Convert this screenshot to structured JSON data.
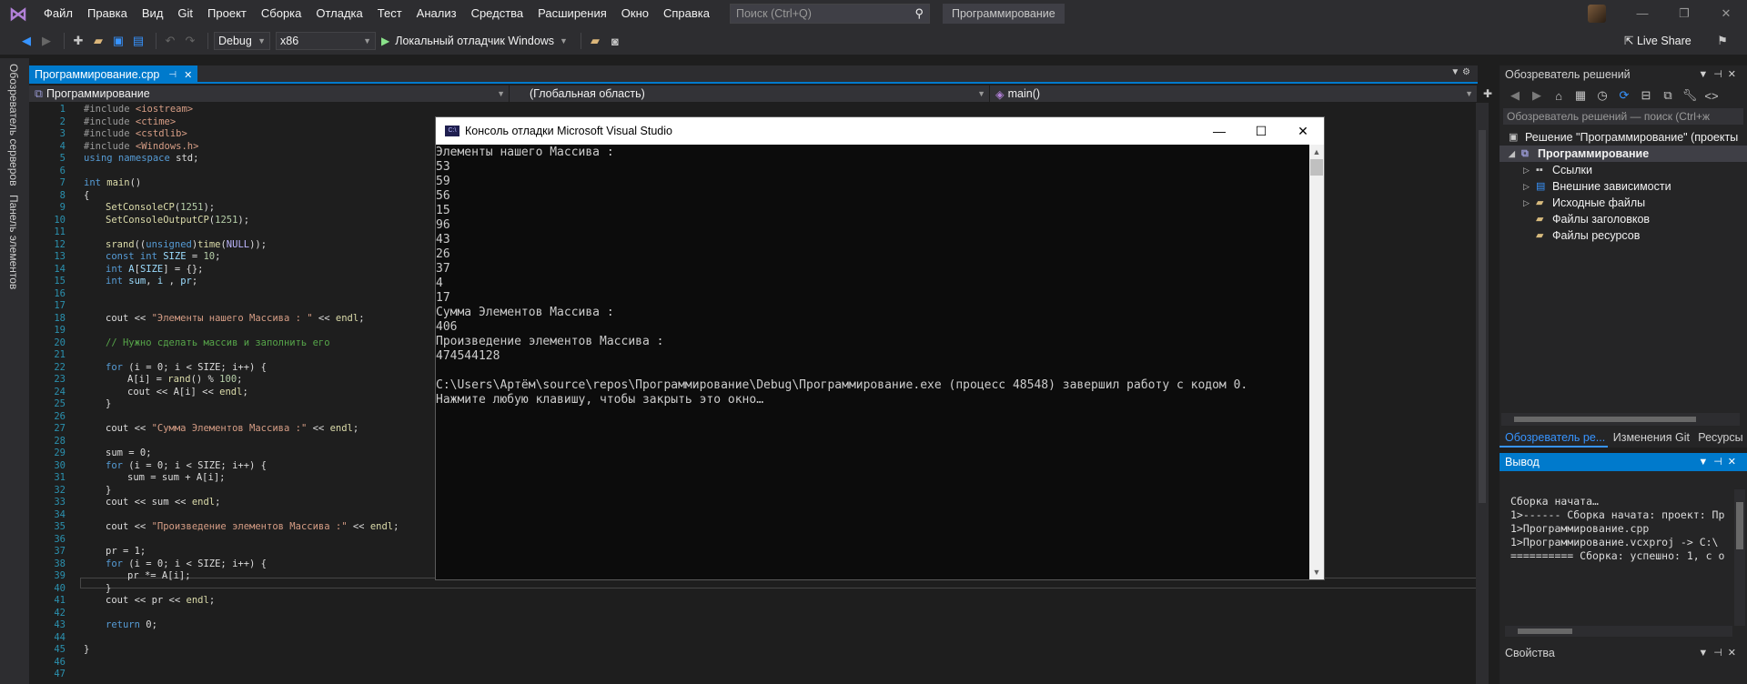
{
  "menubar": {
    "items": [
      "Файл",
      "Правка",
      "Вид",
      "Git",
      "Проект",
      "Сборка",
      "Отладка",
      "Тест",
      "Анализ",
      "Средства",
      "Расширения",
      "Окно",
      "Справка"
    ],
    "search_placeholder": "Поиск (Ctrl+Q)",
    "project_name": "Программирование"
  },
  "toolbar": {
    "config": "Debug",
    "platform": "x86",
    "run_label": "Локальный отладчик Windows",
    "liveshare": "Live Share"
  },
  "leftstrip": {
    "tab1": "Обозреватель серверов",
    "tab2": "Панель элементов"
  },
  "editor": {
    "tab_title": "Программирование.cpp",
    "nav_project": "Программирование",
    "nav_scope": "(Глобальная область)",
    "nav_member": "main()",
    "line_numbers": [
      "1",
      "2",
      "3",
      "4",
      "5",
      "6",
      "7",
      "8",
      "9",
      "10",
      "11",
      "12",
      "13",
      "14",
      "15",
      "16",
      "17",
      "18",
      "19",
      "20",
      "21",
      "22",
      "23",
      "24",
      "25",
      "26",
      "27",
      "28",
      "29",
      "30",
      "31",
      "32",
      "33",
      "34",
      "35",
      "36",
      "37",
      "38",
      "39",
      "40",
      "41",
      "42",
      "43",
      "44",
      "45",
      "46",
      "47"
    ],
    "code": {
      "l1_pp": "#include ",
      "l1_inc": "<iostream>",
      "l2_pp": "#include ",
      "l2_inc": "<ctime>",
      "l3_pp": "#include ",
      "l3_inc": "<cstdlib>",
      "l4_pp": "#include ",
      "l4_inc": "<Windows.h>",
      "l5_kw": "using namespace",
      "l5_rest": " std;",
      "l7_kw": "int",
      "l7_fn": " main",
      "l7_rest": "()",
      "l8": "{",
      "l9_fn": "SetConsoleCP",
      "l9_rest": "(",
      "l9_num": "1251",
      "l9_end": ");",
      "l10_fn": "SetConsoleOutputCP",
      "l10_rest": "(",
      "l10_num": "1251",
      "l10_end": ");",
      "l12_fn": "srand",
      "l12_a": "((",
      "l12_kw": "unsigned",
      "l12_b": ")",
      "l12_fn2": "time",
      "l12_c": "(",
      "l12_mac": "NULL",
      "l12_d": "));",
      "l13_kw": "const int",
      "l13_var": " SIZE",
      "l13_a": " = ",
      "l13_num": "10",
      "l13_b": ";",
      "l14_kw": "int",
      "l14_var": " A",
      "l14_a": "[",
      "l14_var2": "SIZE",
      "l14_b": "] = {};",
      "l15_kw": "int",
      "l15_var": " sum",
      "l15_a": ", ",
      "l15_var2": "i",
      "l15_b": " , ",
      "l15_var3": "pr",
      "l15_c": ";",
      "l18_a": "cout << ",
      "l18_str": "\"Элементы нашего Массива : \"",
      "l18_b": " << ",
      "l18_fn": "endl",
      "l18_c": ";",
      "l20_cmt": "// Нужно сделать массив и заполнить его",
      "l22_kw": "for",
      "l22_rest": " (i = 0; i < SIZE; i++) {",
      "l23_a": "A[i] = ",
      "l23_fn": "rand",
      "l23_b": "() % ",
      "l23_num": "100",
      "l23_c": ";",
      "l24_a": "cout << A[i] << ",
      "l24_fn": "endl",
      "l24_b": ";",
      "l25": "}",
      "l27_a": "cout << ",
      "l27_str": "\"Сумма Элементов Массива :\"",
      "l27_b": " << ",
      "l27_fn": "endl",
      "l27_c": ";",
      "l29": "sum = 0;",
      "l30_kw": "for",
      "l30_rest": " (i = 0; i < SIZE; i++) {",
      "l31": "sum = sum + A[i];",
      "l32": "}",
      "l33_a": "cout << sum << ",
      "l33_fn": "endl",
      "l33_b": ";",
      "l35_a": "cout << ",
      "l35_str": "\"Произведение элементов Массива :\"",
      "l35_b": " << ",
      "l35_fn": "endl",
      "l35_c": ";",
      "l37": "pr = 1;",
      "l38_kw": "for",
      "l38_rest": " (i = 0; i < SIZE; i++) {",
      "l39": "pr *= A[i];",
      "l40": "}",
      "l41_a": "cout << pr << ",
      "l41_fn": "endl",
      "l41_b": ";",
      "l43_kw": "return",
      "l43_rest": " 0;",
      "l45": "}"
    }
  },
  "console": {
    "title": "Консоль отладки Microsoft Visual Studio",
    "lines": [
      "Элементы нашего Массива :",
      "53",
      "59",
      "56",
      "15",
      "96",
      "43",
      "26",
      "37",
      "4",
      "17",
      "Сумма Элементов Массива :",
      "406",
      "Произведение элементов Массива :",
      "474544128",
      "",
      "C:\\Users\\Артём\\source\\repos\\Программирование\\Debug\\Программирование.exe (процесс 48548) завершил работу с кодом 0.",
      "Нажмите любую клавишу, чтобы закрыть это окно…"
    ]
  },
  "solution_explorer": {
    "title": "Обозреватель решений",
    "search_placeholder": "Обозреватель решений — поиск (Ctrl+ж",
    "solution": "Решение \"Программирование\" (проекты",
    "project": "Программирование",
    "nodes": [
      "Ссылки",
      "Внешние зависимости",
      "Исходные файлы",
      "Файлы заголовков",
      "Файлы ресурсов"
    ],
    "tabs": [
      "Обозреватель ре...",
      "Изменения Git",
      "Ресурсы"
    ]
  },
  "output": {
    "title": "Вывод",
    "lines": [
      "Сборка начата…",
      "1>------ Сборка начата: проект: Пр",
      "1>Программирование.cpp",
      "1>Программирование.vcxproj -> C:\\",
      "========== Сборка: успешно: 1, с о"
    ]
  },
  "properties": {
    "title": "Свойства"
  }
}
